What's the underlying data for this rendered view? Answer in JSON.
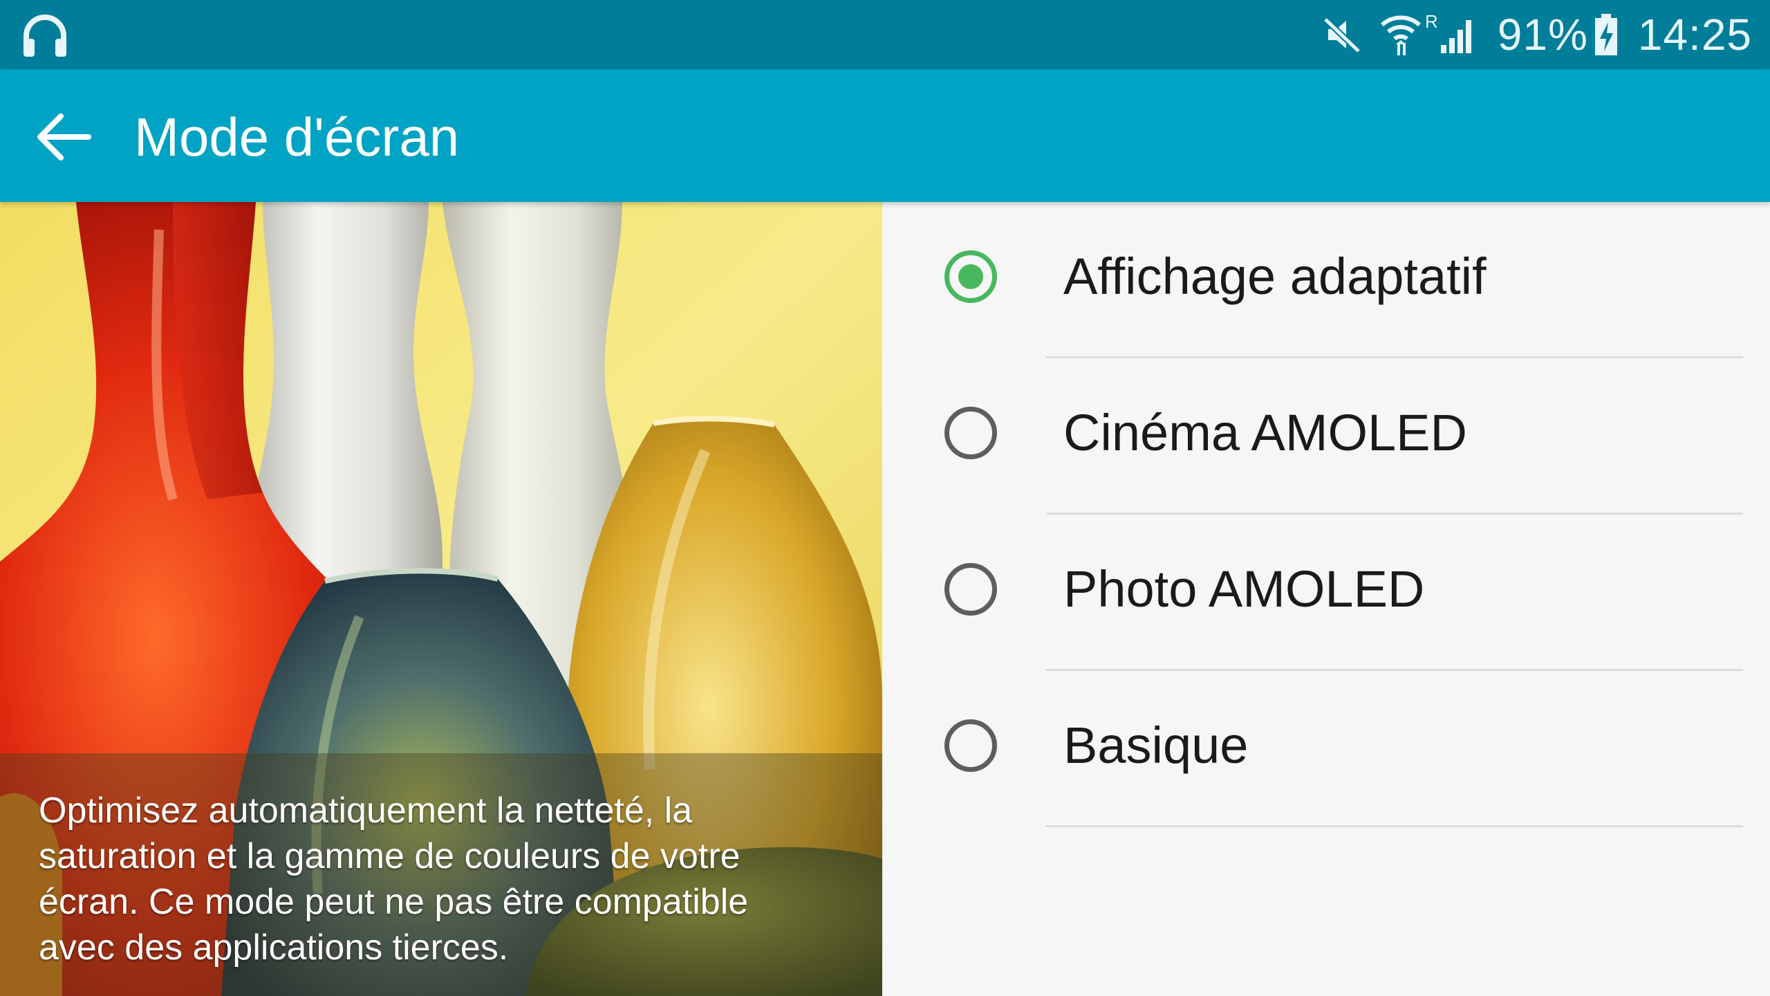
{
  "status_bar": {
    "battery": "91%",
    "time": "14:25",
    "icons": [
      "headset-icon",
      "mute-icon",
      "wifi-icon",
      "signal-icon",
      "battery-charging-icon"
    ],
    "roaming": "R"
  },
  "action_bar": {
    "title": "Mode d'écran",
    "back_icon": "back-arrow-icon"
  },
  "preview": {
    "caption": "Optimisez automatiquement la netteté, la saturation et la gamme de couleurs de votre écran. Ce mode peut ne pas être compatible avec des applications tierces."
  },
  "options": [
    {
      "label": "Affichage adaptatif",
      "selected": true
    },
    {
      "label": "Cinéma AMOLED",
      "selected": false
    },
    {
      "label": "Photo AMOLED",
      "selected": false
    },
    {
      "label": "Basique",
      "selected": false
    }
  ],
  "colors": {
    "status_bar": "#007d99",
    "action_bar": "#00a3c4",
    "radio_selected": "#48b85e",
    "radio_unselected": "#5e5e5e"
  }
}
